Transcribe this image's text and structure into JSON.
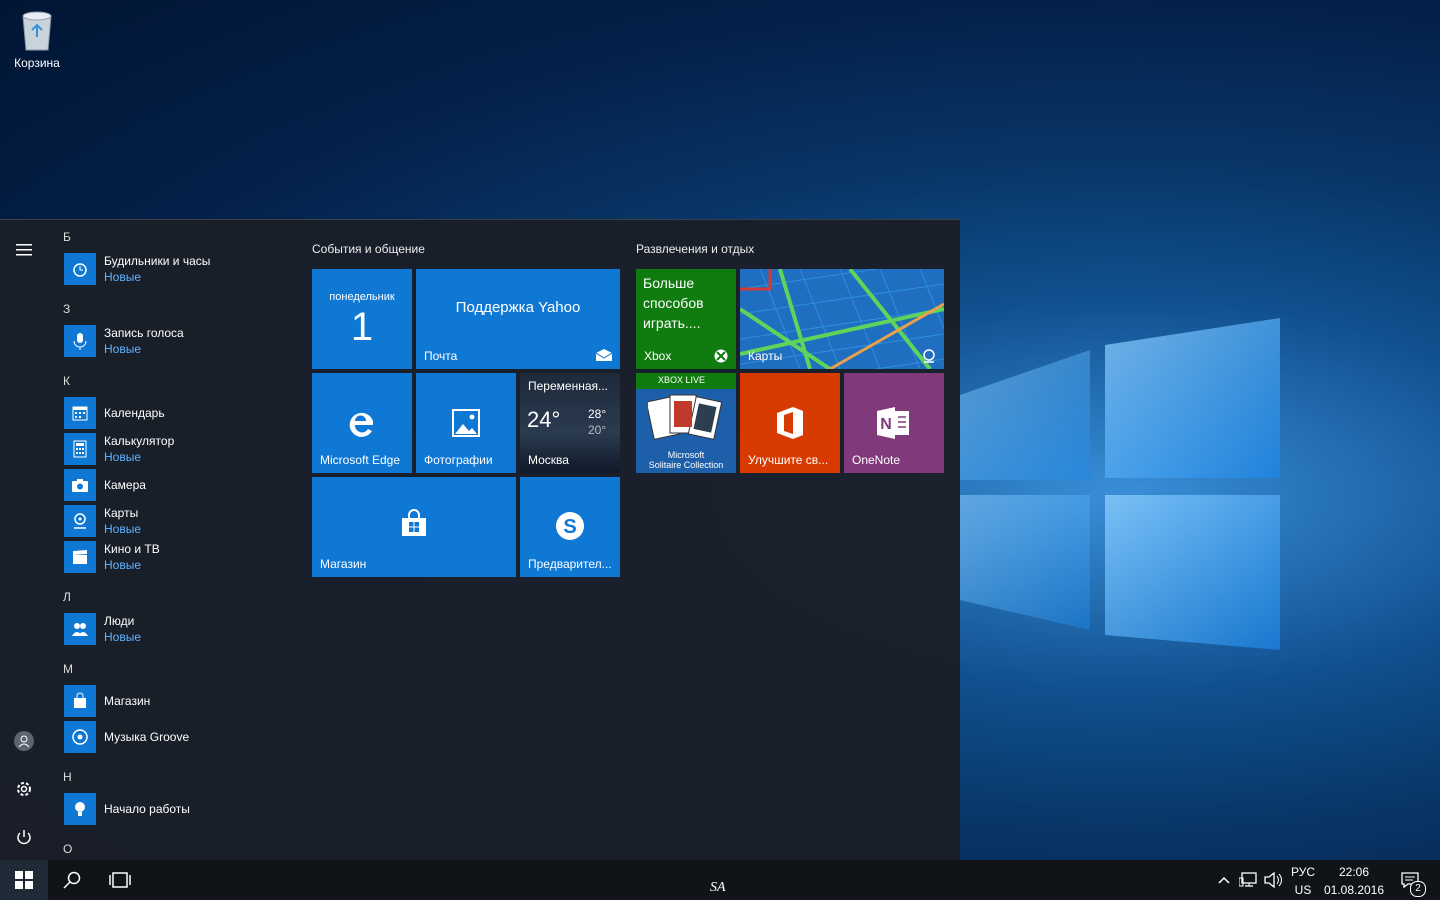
{
  "desktop": {
    "recycle_bin_label": "Корзина"
  },
  "start_menu": {
    "letters": [
      "Б",
      "З",
      "К",
      "Л",
      "М",
      "Н",
      "О"
    ],
    "apps": [
      {
        "name": "Будильники и часы",
        "badge": "Новые"
      },
      {
        "name": "Запись голоса",
        "badge": "Новые"
      },
      {
        "name": "Календарь"
      },
      {
        "name": "Калькулятор",
        "badge": "Новые"
      },
      {
        "name": "Камера"
      },
      {
        "name": "Карты",
        "badge": "Новые"
      },
      {
        "name": "Кино и ТВ",
        "badge": "Новые"
      },
      {
        "name": "Люди",
        "badge": "Новые"
      },
      {
        "name": "Магазин"
      },
      {
        "name": "Музыка Groove"
      },
      {
        "name": "Начало работы"
      }
    ],
    "groups": [
      {
        "title": "События и общение"
      },
      {
        "title": "Развлечения и отдых"
      }
    ],
    "tiles": {
      "calendar": {
        "day": "понедельник",
        "date": "1"
      },
      "mail": {
        "title": "Поддержка Yahoo",
        "label": "Почта"
      },
      "edge": {
        "label": "Microsoft Edge"
      },
      "photos": {
        "label": "Фотографии"
      },
      "weather": {
        "title": "Переменная...",
        "temp": "24°",
        "high": "28°",
        "low": "20°",
        "city": "Москва"
      },
      "store": {
        "label": "Магазин"
      },
      "skype": {
        "label": "Предварител..."
      },
      "xbox": {
        "promo": "Больше способов играть....",
        "label": "Xbox"
      },
      "maps": {
        "label": "Карты"
      },
      "solitaire": {
        "badge": "XBOX LIVE",
        "line1": "Microsoft",
        "line2": "Solitaire Collection"
      },
      "office": {
        "label": "Улучшите св..."
      },
      "onenote": {
        "label": "OneNote"
      }
    }
  },
  "taskbar": {
    "watermark": "SA",
    "lang_top": "РУС",
    "lang_bottom": "US",
    "time": "22:06",
    "date": "01.08.2016",
    "notifications_count": "2"
  }
}
